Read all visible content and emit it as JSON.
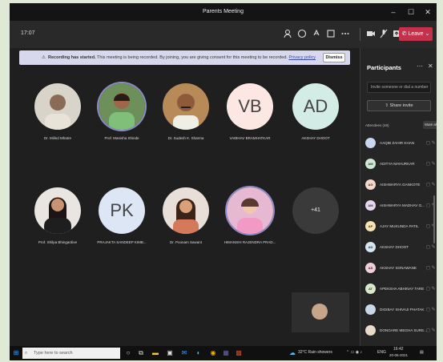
{
  "window": {
    "title": "Parents Meeting",
    "minimize": "–",
    "maximize": "☐",
    "close": "✕"
  },
  "toolbar": {
    "timer": "17:07",
    "leave_label": "Leave"
  },
  "banner": {
    "bold": "Recording has started.",
    "text": "This meeting is being recorded. By joining, you are giving consent for this meeting to be recorded.",
    "link": "Privacy policy",
    "dismiss": "Dismiss"
  },
  "tiles": [
    {
      "name": "Dr. Milind Mhatre",
      "initials": ""
    },
    {
      "name": "Prof. Manisha Shinde",
      "initials": ""
    },
    {
      "name": "Dr. Sudesh K. Sharma",
      "initials": ""
    },
    {
      "name": "VAIBHAV BRAMHATKAR",
      "initials": "VB"
    },
    {
      "name": "AKSHAY DHOOT",
      "initials": "AD"
    },
    {
      "name": "Prof. Shilpa Bhingardive",
      "initials": ""
    },
    {
      "name": "PRAJAKTA SANDEEP KIMB...",
      "initials": "PK"
    },
    {
      "name": "Dr. Poonam Sawant",
      "initials": ""
    },
    {
      "name": "HIMANSHI RAJENDRA PRAD...",
      "initials": ""
    },
    {
      "name": "",
      "initials": "+41"
    }
  ],
  "panel": {
    "title": "Participants",
    "invite_placeholder": "Invite someone or dial a number",
    "share_invite": "Share invite",
    "attendees_label": "Attendees (49)",
    "mute_all": "Mute all",
    "attendees": [
      {
        "initials": "",
        "name": "AAQIB ZAHIR KHAN"
      },
      {
        "initials": "AM",
        "name": "ADITYA MAHURKAR"
      },
      {
        "initials": "AG",
        "name": "AISHWARYA GANKOTE"
      },
      {
        "initials": "AM",
        "name": "AISHWARYA MADHAV G..."
      },
      {
        "initials": "AP",
        "name": "AJAY MUKUNDA PATIL"
      },
      {
        "initials": "AD",
        "name": "AKSHAY DHOOT"
      },
      {
        "initials": "AS",
        "name": "AKSHAY SONAWANE"
      },
      {
        "initials": "AT",
        "name": "APEKSHA ABHINAY TARE"
      },
      {
        "initials": "",
        "name": "DIGIBAY SHIVAJI PHATAK"
      },
      {
        "initials": "",
        "name": "DONGARE MEGHA SURE..."
      }
    ]
  },
  "taskbar": {
    "search_placeholder": "Type here to search",
    "weather": "32°C Rain showers",
    "lang": "ENG",
    "time": "16:42",
    "date": "20-06-2021"
  },
  "colors": {
    "leave": "#c4314b",
    "banner": "#d7d8ee",
    "ring": "#8b8cc7"
  }
}
